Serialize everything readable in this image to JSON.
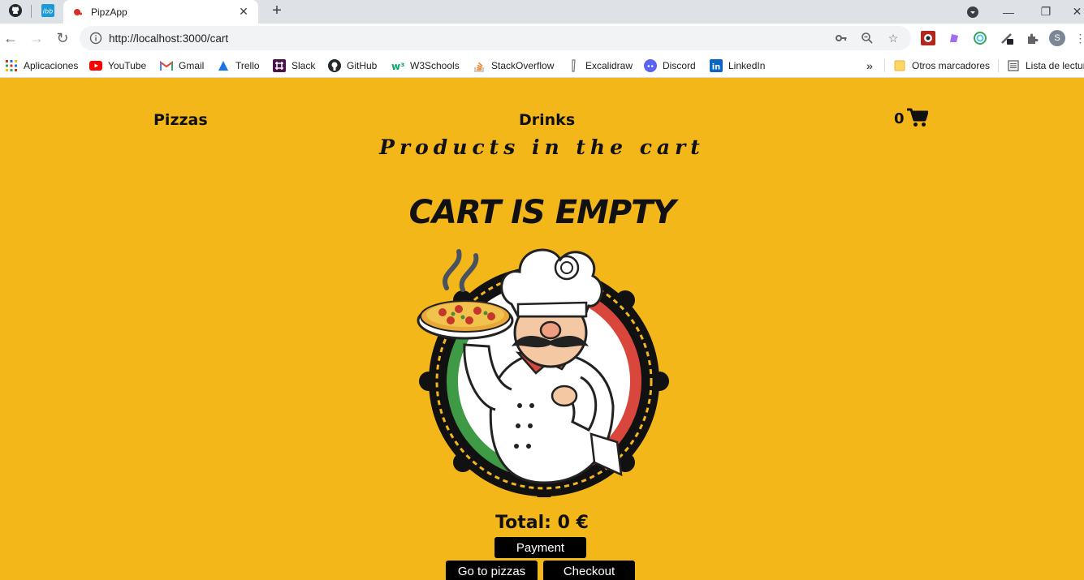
{
  "browser": {
    "tab_title": "PipzApp",
    "url": "http://localhost:3000/cart",
    "profile_initial": "S",
    "bookmarks": [
      {
        "label": "Aplicaciones",
        "icon": "apps-grid-icon"
      },
      {
        "label": "YouTube",
        "icon": "youtube-icon"
      },
      {
        "label": "Gmail",
        "icon": "gmail-icon"
      },
      {
        "label": "Trello",
        "icon": "trello-icon"
      },
      {
        "label": "Slack",
        "icon": "slack-icon"
      },
      {
        "label": "GitHub",
        "icon": "github-icon"
      },
      {
        "label": "W3Schools",
        "icon": "w3schools-icon"
      },
      {
        "label": "StackOverflow",
        "icon": "stackoverflow-icon"
      },
      {
        "label": "Excalidraw",
        "icon": "excalidraw-icon"
      },
      {
        "label": "Discord",
        "icon": "discord-icon"
      },
      {
        "label": "LinkedIn",
        "icon": "linkedin-icon"
      }
    ],
    "more_bookmarks": "»",
    "other_bookmarks": "Otros marcadores",
    "reading_list": "Lista de lectura"
  },
  "nav": {
    "pizzas": "Pizzas",
    "drinks": "Drinks",
    "cart_count": "0"
  },
  "cart": {
    "subtitle": "Products in the cart",
    "empty_message": "CART IS EMPTY",
    "total_label": "Total: 0 €"
  },
  "buttons": {
    "payment": "Payment",
    "go_to_pizzas": "Go to pizzas",
    "checkout": "Checkout"
  },
  "colors": {
    "page_background": "#f3b719",
    "button_background": "#000000",
    "text": "#111111"
  }
}
